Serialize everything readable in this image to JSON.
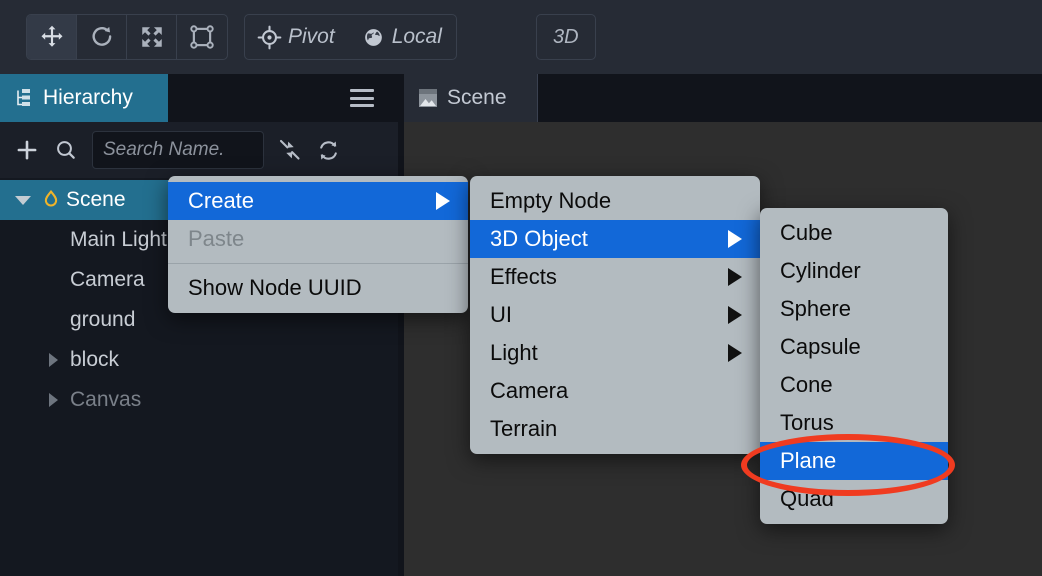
{
  "toolbar": {
    "tools": [
      {
        "name": "move-tool",
        "icon": "move-icon",
        "active": true
      },
      {
        "name": "rotate-tool",
        "icon": "rotate-icon",
        "active": false
      },
      {
        "name": "scale-tool",
        "icon": "scale-icon",
        "active": false
      },
      {
        "name": "rect-transform-tool",
        "icon": "rect-transform-icon",
        "active": false
      }
    ],
    "pivot_label": "Pivot",
    "coord_label": "Local",
    "threed_label": "3D"
  },
  "hierarchy": {
    "tab_label": "Hierarchy",
    "tab_icon": "hierarchy-icon",
    "menu_icon": "hamburger-icon",
    "add_icon": "plus-icon",
    "search_icon": "search-icon",
    "collapse_icon": "collapse-all-icon",
    "refresh_icon": "refresh-icon",
    "search_placeholder": "Search Name.",
    "search_value": "",
    "tree": [
      {
        "label": "Scene",
        "depth": 0,
        "expanded": true,
        "selected": true,
        "dim": false,
        "icon": "scene-flame-icon",
        "twisty": "down"
      },
      {
        "label": "Main Light",
        "depth": 1,
        "expanded": false,
        "selected": false,
        "dim": false,
        "icon": "",
        "twisty": "none"
      },
      {
        "label": "Camera",
        "depth": 1,
        "expanded": false,
        "selected": false,
        "dim": false,
        "icon": "",
        "twisty": "none"
      },
      {
        "label": "ground",
        "depth": 1,
        "expanded": false,
        "selected": false,
        "dim": false,
        "icon": "",
        "twisty": "none"
      },
      {
        "label": "block",
        "depth": 1,
        "expanded": false,
        "selected": false,
        "dim": false,
        "icon": "",
        "twisty": "right"
      },
      {
        "label": "Canvas",
        "depth": 1,
        "expanded": false,
        "selected": false,
        "dim": true,
        "icon": "",
        "twisty": "right"
      }
    ]
  },
  "scene": {
    "tab_label": "Scene",
    "tab_icon": "scene-image-icon"
  },
  "context_menu": {
    "items": [
      {
        "label": "Create",
        "submenu": true,
        "selected": true,
        "disabled": false
      },
      {
        "label": "Paste",
        "submenu": false,
        "selected": false,
        "disabled": true
      },
      {
        "separator": true
      },
      {
        "label": "Show Node UUID",
        "submenu": false,
        "selected": false,
        "disabled": false
      }
    ]
  },
  "create_menu": {
    "items": [
      {
        "label": "Empty Node",
        "submenu": false,
        "selected": false
      },
      {
        "label": "3D Object",
        "submenu": true,
        "selected": true
      },
      {
        "label": "Effects",
        "submenu": true,
        "selected": false
      },
      {
        "label": "UI",
        "submenu": true,
        "selected": false
      },
      {
        "label": "Light",
        "submenu": true,
        "selected": false
      },
      {
        "label": "Camera",
        "submenu": false,
        "selected": false
      },
      {
        "label": "Terrain",
        "submenu": false,
        "selected": false
      }
    ]
  },
  "object_menu": {
    "items": [
      {
        "label": "Cube",
        "submenu": false,
        "selected": false
      },
      {
        "label": "Cylinder",
        "submenu": false,
        "selected": false
      },
      {
        "label": "Sphere",
        "submenu": false,
        "selected": false
      },
      {
        "label": "Capsule",
        "submenu": false,
        "selected": false
      },
      {
        "label": "Cone",
        "submenu": false,
        "selected": false
      },
      {
        "label": "Torus",
        "submenu": false,
        "selected": false
      },
      {
        "label": "Plane",
        "submenu": false,
        "selected": true
      },
      {
        "label": "Quad",
        "submenu": false,
        "selected": false
      }
    ]
  },
  "annotation": {
    "shape": "ellipse",
    "color": "#f03b20",
    "target_label": "Plane"
  },
  "colors": {
    "toolbar_bg": "#262b35",
    "panel_bg": "#141820",
    "viewport_bg": "#2e2e2e",
    "tab_active": "#236f8f",
    "menu_bg": "#b3bbc0",
    "menu_highlight": "#1268d8",
    "annotation": "#f03b20"
  }
}
